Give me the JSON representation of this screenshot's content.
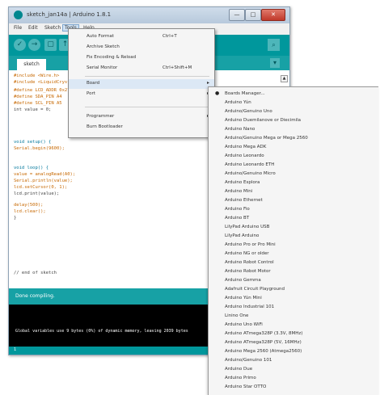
{
  "window": {
    "title": "sketch_jan14a | Arduino 1.8.1",
    "min": "—",
    "max": "□",
    "close": "✕"
  },
  "menu": [
    "File",
    "Edit",
    "Sketch",
    "Tools",
    "Help"
  ],
  "tab": {
    "name": "sketch",
    "dropdown": "▾"
  },
  "toolbar": {
    "verify": "✓",
    "upload": "→",
    "new": "▢",
    "open": "↑",
    "save": "↓",
    "serial": "⌕"
  },
  "editor": {
    "lines": [
      "#include <Wire.h>",
      "#include <LiquidCrystal.h>",
      "  #define LCD_ADDR 0x27",
      "  #define SDA_PIN  A4",
      "  #define SCL_PIN  A5",
      "  int value = 0;",
      "",
      "void setup() {",
      "  Serial.begin(9600);",
      "",
      "void loop() {",
      "  value = analogRead(A0);",
      "  Serial.println(value);",
      "  lcd.setCursor(0, 1);",
      "  lcd.print(value);",
      "  delay(500);",
      "  lcd.clear();",
      "}",
      "",
      "",
      "  // end of sketch"
    ]
  },
  "status": {
    "text": "Done compiling.",
    "console": "Global variables use 9 bytes (0%) of dynamic memory, leaving 2039 bytes",
    "footer": "1"
  },
  "tools_menu": {
    "items": [
      {
        "label": "Auto Format",
        "shortcut": "Ctrl+T"
      },
      {
        "label": "Archive Sketch",
        "shortcut": ""
      },
      {
        "label": "Fix Encoding & Reload",
        "shortcut": ""
      },
      {
        "label": "Serial Monitor",
        "shortcut": "Ctrl+Shift+M"
      },
      {
        "label": "Board",
        "shortcut": "",
        "arrow": "▸"
      },
      {
        "label": "Port",
        "shortcut": "",
        "arrow": "▸"
      },
      {
        "label": "Programmer",
        "shortcut": "",
        "arrow": "▸"
      },
      {
        "label": "Burn Bootloader",
        "shortcut": ""
      }
    ]
  },
  "boards_menu": {
    "selected_mark": "●",
    "items": [
      "Boards Manager...",
      "Arduino Yún",
      "Arduino/Genuino Uno",
      "Arduino Duemilanove or Diecimila",
      "Arduino Nano",
      "Arduino/Genuino Mega or Mega 2560",
      "Arduino Mega ADK",
      "Arduino Leonardo",
      "Arduino Leonardo ETH",
      "Arduino/Genuino Micro",
      "Arduino Esplora",
      "Arduino Mini",
      "Arduino Ethernet",
      "Arduino Fio",
      "Arduino BT",
      "LilyPad Arduino USB",
      "LilyPad Arduino",
      "Arduino Pro or Pro Mini",
      "Arduino NG or older",
      "Arduino Robot Control",
      "Arduino Robot Motor",
      "Arduino Gemma",
      "Adafruit Circuit Playground",
      "Arduino Yún Mini",
      "Arduino Industrial 101",
      "Linino One",
      "Arduino Uno WiFi",
      "Arduino ATmega328P (3.3V, 8MHz)",
      "Arduino ATmega328P (5V, 16MHz)",
      "Arduino Mega 2560 (Atmega2560)",
      "Arduino/Genuino 101",
      "Arduino Due",
      "Arduino Primo",
      "Arduino Star OTTO"
    ]
  }
}
